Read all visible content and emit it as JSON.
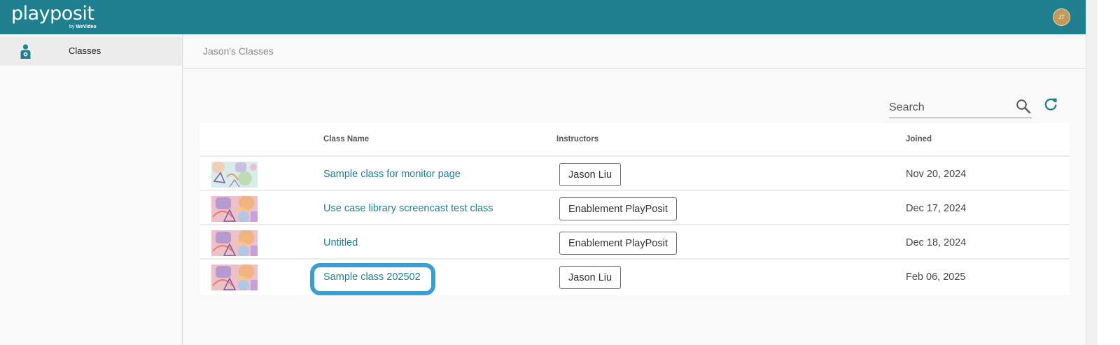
{
  "app": {
    "logo_text": "playposit",
    "logo_by": "by",
    "logo_brand": "WeVideo",
    "avatar_initials": "JT",
    "brand_color": "#1f7f8f"
  },
  "sidebar": {
    "items": [
      {
        "label": "Classes",
        "icon": "classes-person-icon",
        "active": true
      }
    ]
  },
  "page": {
    "title": "Jason's Classes"
  },
  "search": {
    "placeholder": "Search",
    "value": ""
  },
  "table": {
    "columns": [
      "",
      "Class Name",
      "Instructors",
      "Joined"
    ],
    "rows": [
      {
        "class_name": "Sample class for monitor page",
        "instructor": "Jason Liu",
        "joined": "Nov 20, 2024",
        "thumb": "pastel-light"
      },
      {
        "class_name": "Use case library screencast test class",
        "instructor": "Enablement PlayPosit",
        "joined": "Dec 17, 2024",
        "thumb": "pastel-pink"
      },
      {
        "class_name": "Untitled",
        "instructor": "Enablement PlayPosit",
        "joined": "Dec 18, 2024",
        "thumb": "pastel-pink"
      },
      {
        "class_name": "Sample class 202502",
        "instructor": "Jason Liu",
        "joined": "Feb 06, 2025",
        "thumb": "pastel-pink",
        "highlighted": true
      }
    ]
  }
}
